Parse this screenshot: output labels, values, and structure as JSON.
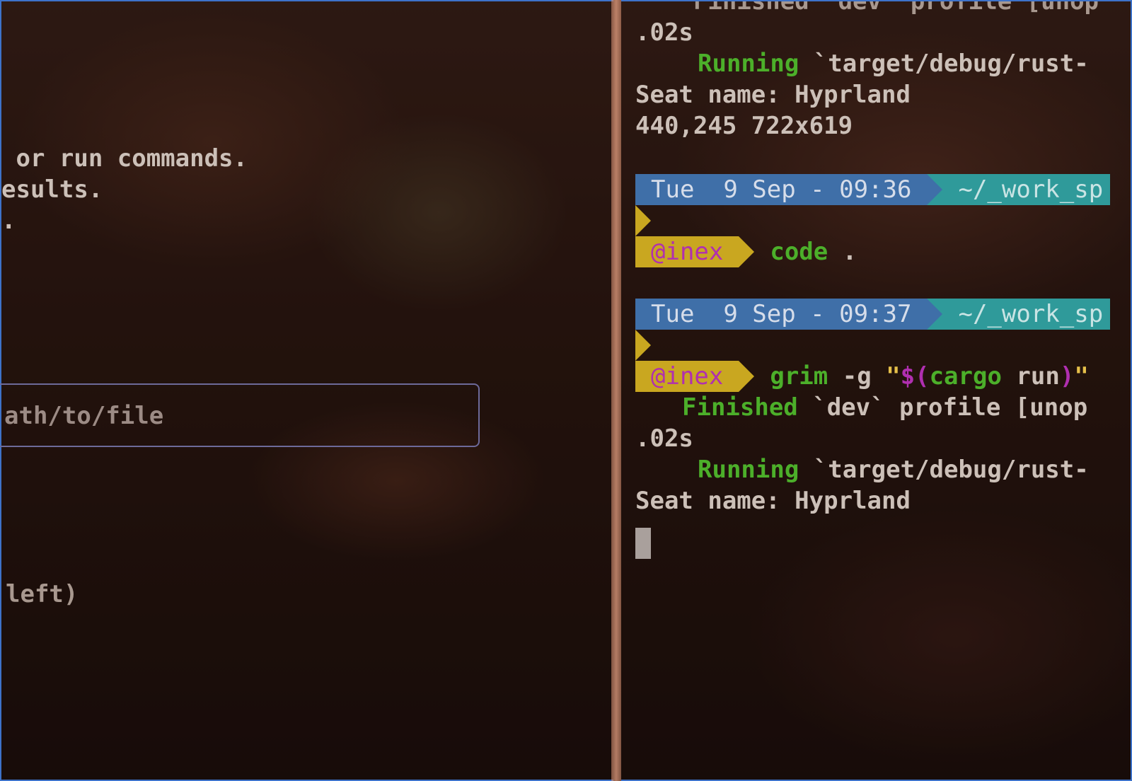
{
  "left_pane": {
    "line1": " or run commands.",
    "line2": "esults.",
    "line3": ".",
    "input_placeholder": "ath/to/file",
    "hint": "left)"
  },
  "right_pane": {
    "top_partial": "    Finished `dev` profile [unop",
    "line_02s_a": ".02s",
    "running_a_label": "Running",
    "running_a_rest": " `target/debug/rust-",
    "seat_a": "Seat name: Hyprland",
    "geometry": "440,245 722x619",
    "prompt1": {
      "date": "Tue  9 Sep - 09:36",
      "path": "~/_work_sp",
      "user": "@inex",
      "cmd": "code",
      "arg": " ."
    },
    "prompt2": {
      "date": "Tue  9 Sep - 09:37",
      "path": "~/_work_sp",
      "user": "@inex",
      "cmd": "grim",
      "flag": " -g ",
      "q1": "\"",
      "subst": "$(",
      "cargo": "cargo",
      "run": " run",
      "close": ")",
      "q2": "\""
    },
    "finished_label": "Finished",
    "finished_rest": " `dev` profile [unop",
    "line_02s_b": ".02s",
    "running_b_label": "Running",
    "running_b_rest": " `target/debug/rust-",
    "seat_b": "Seat name: Hyprland"
  },
  "colors": {
    "border": "#3d72c9",
    "green": "#4caf2a",
    "magenta": "#b02fb0",
    "yellow": "#c9a720",
    "blue": "#3f6fa8",
    "teal": "#2f9a9a"
  }
}
